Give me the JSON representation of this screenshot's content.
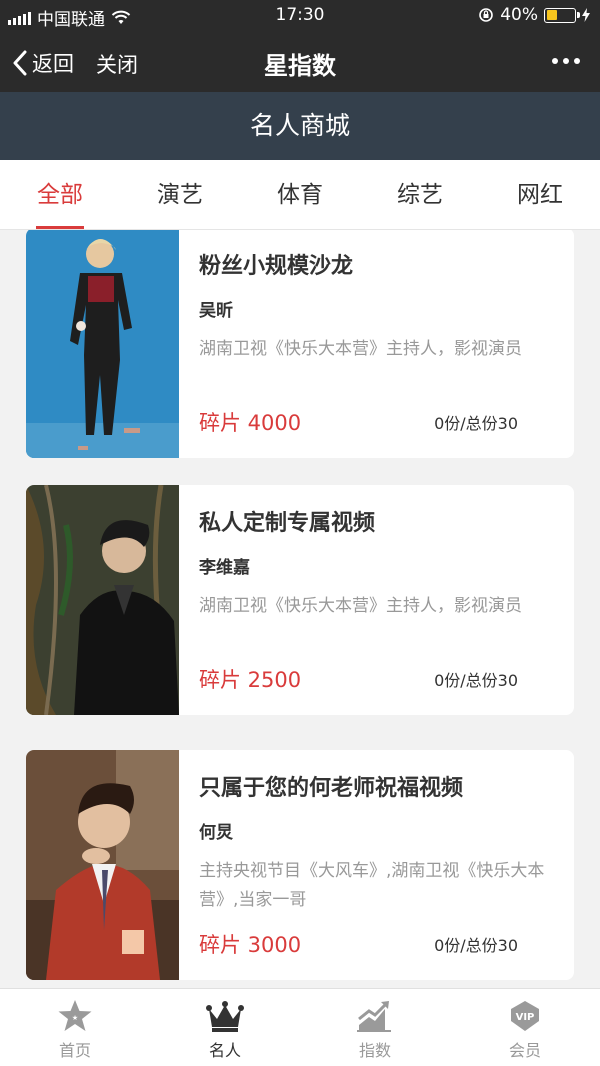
{
  "status_bar": {
    "carrier": "中国联通",
    "time": "17:30",
    "battery": "40%",
    "battery_level": 0.4
  },
  "nav": {
    "back_label": "返回",
    "close_label": "关闭",
    "title": "星指数"
  },
  "page_header": {
    "title": "名人商城"
  },
  "tabs": [
    {
      "label": "全部",
      "active": true
    },
    {
      "label": "演艺",
      "active": false
    },
    {
      "label": "体育",
      "active": false
    },
    {
      "label": "综艺",
      "active": false
    },
    {
      "label": "网红",
      "active": false
    }
  ],
  "products": [
    {
      "title": "粉丝小规模沙龙",
      "celebrity": "吴昕",
      "description": "湖南卫视《快乐大本营》主持人，影视演员",
      "price": "碎片 4000",
      "stock": "0份/总份30"
    },
    {
      "title": "私人定制专属视频",
      "celebrity": "李维嘉",
      "description": "湖南卫视《快乐大本营》主持人，影视演员",
      "price": "碎片 2500",
      "stock": "0份/总份30"
    },
    {
      "title": "只属于您的何老师祝福视频",
      "celebrity": "何炅",
      "description": "主持央视节目《大风车》,湖南卫视《快乐大本营》,当家一哥",
      "price": "碎片 3000",
      "stock": "0份/总份30"
    }
  ],
  "bottom_nav": [
    {
      "label": "首页",
      "icon": "star-icon",
      "active": false
    },
    {
      "label": "名人",
      "icon": "crown-icon",
      "active": true
    },
    {
      "label": "指数",
      "icon": "chart-icon",
      "active": false
    },
    {
      "label": "会员",
      "icon": "vip-icon",
      "active": false
    }
  ],
  "colors": {
    "accent": "#d93b3b",
    "header_dark": "#2b2b2b",
    "header_slate": "#34404c"
  }
}
